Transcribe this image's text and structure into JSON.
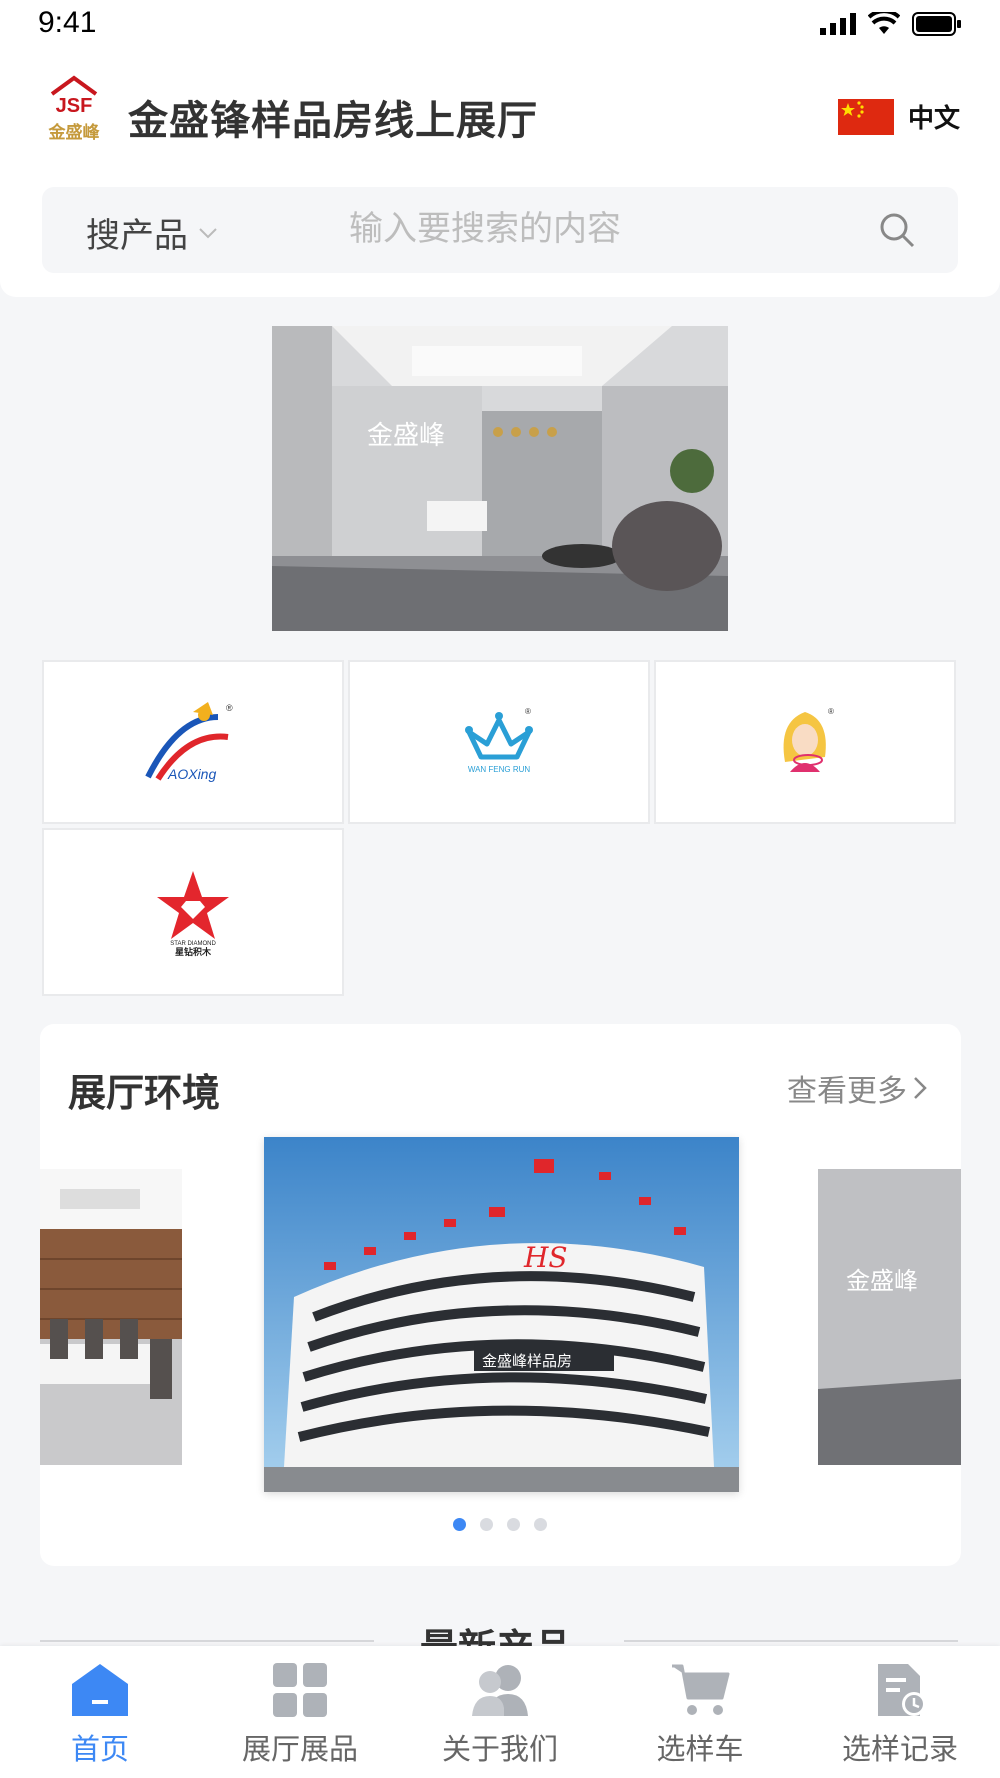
{
  "status": {
    "time": "9:41"
  },
  "header": {
    "logo_text": "JSF",
    "logo_sub": "金盛峰",
    "title": "金盛锋样品房线上展厅",
    "language": "中文"
  },
  "search": {
    "type_label": "搜产品",
    "placeholder": "输入要搜索的内容"
  },
  "brands": [
    {
      "name": "AOXing",
      "icon": "aoxing-logo"
    },
    {
      "name": "WAN FENG RUN",
      "icon": "crown-logo"
    },
    {
      "name": "brand-girl",
      "icon": "girl-logo"
    },
    {
      "name": "STAR DIAMOND 星钻积木",
      "icon": "star-logo"
    }
  ],
  "env": {
    "title": "展厅环境",
    "more_label": "查看更多",
    "slide_count": 4,
    "active_slide": 0
  },
  "latest": {
    "title": "最新产品"
  },
  "tabs": [
    {
      "label": "首页",
      "icon": "home-icon",
      "active": true
    },
    {
      "label": "展厅展品",
      "icon": "grid-icon",
      "active": false
    },
    {
      "label": "关于我们",
      "icon": "people-icon",
      "active": false
    },
    {
      "label": "选样车",
      "icon": "cart-icon",
      "active": false
    },
    {
      "label": "选样记录",
      "icon": "record-icon",
      "active": false
    }
  ],
  "colors": {
    "accent": "#3d88f4",
    "flag": "#de2910"
  }
}
